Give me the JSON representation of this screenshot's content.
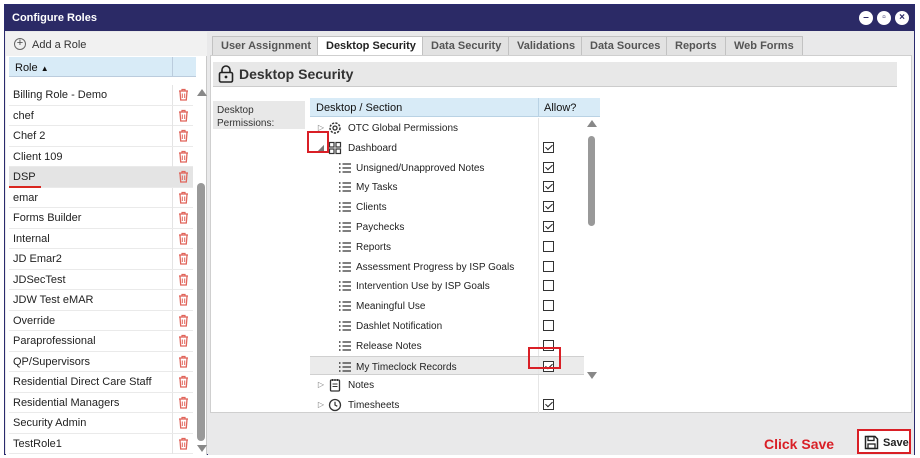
{
  "window": {
    "title": "Configure Roles"
  },
  "left": {
    "add_role_label": "Add a Role",
    "role_header": "Role",
    "roles": [
      "Billing Role - Demo",
      "chef",
      "Chef 2",
      "Client 109",
      "DSP",
      "emar",
      "Forms Builder",
      "Internal",
      "JD Emar2",
      "JDSecTest",
      "JDW Test eMAR",
      "Override",
      "Paraprofessional",
      "QP/Supervisors",
      "Residential Direct Care Staff",
      "Residential Managers",
      "Security Admin",
      "TestRole1"
    ],
    "selected_role": "DSP"
  },
  "tabs": [
    "User Assignment",
    "Desktop Security",
    "Data Security",
    "Validations",
    "Data Sources",
    "Reports",
    "Web Forms"
  ],
  "active_tab": "Desktop Security",
  "page": {
    "title": "Desktop Security",
    "permissions_label": "Desktop Permissions:"
  },
  "tree": {
    "col_section": "Desktop / Section",
    "col_allow": "Allow?",
    "rows": [
      {
        "label": "OTC Global Permissions",
        "level": 0,
        "expand": "collapsed",
        "icon": "gear-icon",
        "checkbox": null
      },
      {
        "label": "Dashboard",
        "level": 0,
        "expand": "expanded",
        "icon": "dashboard-grid-icon",
        "checkbox": true
      },
      {
        "label": "Unsigned/Unapproved Notes",
        "level": 1,
        "icon": "list-icon",
        "checkbox": true
      },
      {
        "label": "My Tasks",
        "level": 1,
        "icon": "list-icon",
        "checkbox": true
      },
      {
        "label": "Clients",
        "level": 1,
        "icon": "list-icon",
        "checkbox": true
      },
      {
        "label": "Paychecks",
        "level": 1,
        "icon": "list-icon",
        "checkbox": true
      },
      {
        "label": "Reports",
        "level": 1,
        "icon": "list-icon",
        "checkbox": false
      },
      {
        "label": "Assessment Progress by ISP Goals",
        "level": 1,
        "icon": "list-icon",
        "checkbox": false
      },
      {
        "label": "Intervention Use by ISP Goals",
        "level": 1,
        "icon": "list-icon",
        "checkbox": false
      },
      {
        "label": "Meaningful Use",
        "level": 1,
        "icon": "list-icon",
        "checkbox": false
      },
      {
        "label": "Dashlet Notification",
        "level": 1,
        "icon": "list-icon",
        "checkbox": false
      },
      {
        "label": "Release Notes",
        "level": 1,
        "icon": "list-icon",
        "checkbox": false
      },
      {
        "label": "My Timeclock Records",
        "level": 1,
        "icon": "list-icon",
        "checkbox": true
      },
      {
        "label": "Notes",
        "level": 0,
        "expand": "collapsed",
        "icon": "notepad-icon",
        "checkbox": null
      },
      {
        "label": "Timesheets",
        "level": 0,
        "expand": "collapsed",
        "icon": "clock-icon",
        "checkbox": true
      }
    ]
  },
  "annotation": {
    "click_save": "Click Save"
  },
  "footer": {
    "save_label": "Save"
  },
  "colors": {
    "title_bar": "#2b2a66",
    "header_blue": "#d8ebf7",
    "annotation_red": "#d91f26",
    "trash_red": "#e0645a"
  }
}
